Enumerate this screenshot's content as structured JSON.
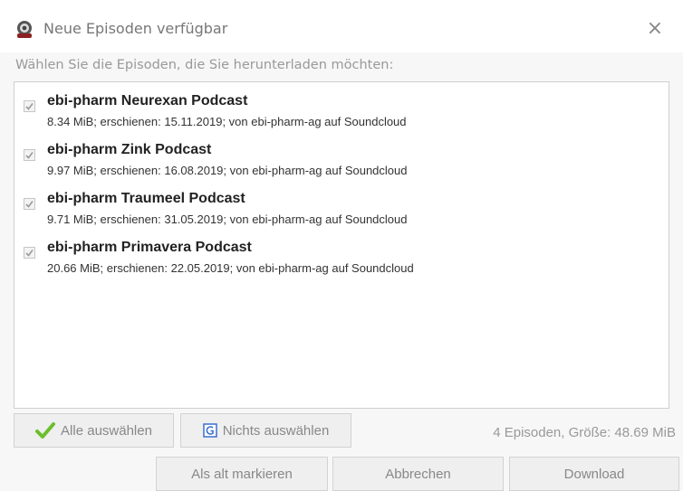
{
  "window": {
    "title": "Neue Episoden verfügbar",
    "close_glyph": "×"
  },
  "prompt": "Wählen Sie die Episoden, die Sie herunterladen möchten:",
  "episodes": [
    {
      "title": "ebi-pharm Neurexan Podcast",
      "meta": "8.34 MiB; erschienen: 15.11.2019; von ebi-pharm-ag auf Soundcloud",
      "checked": true
    },
    {
      "title": "ebi-pharm Zink Podcast",
      "meta": "9.97 MiB; erschienen: 16.08.2019; von ebi-pharm-ag auf Soundcloud",
      "checked": true
    },
    {
      "title": "ebi-pharm Traumeel Podcast",
      "meta": "9.71 MiB; erschienen: 31.05.2019; von ebi-pharm-ag auf Soundcloud",
      "checked": true
    },
    {
      "title": "ebi-pharm Primavera Podcast",
      "meta": "20.66 MiB; erschienen: 22.05.2019; von ebi-pharm-ag auf Soundcloud",
      "checked": true
    }
  ],
  "selection": {
    "select_all_label": "Alle auswählen",
    "select_none_label": "Nichts auswählen",
    "summary": "4 Episoden, Größe: 48.69 MiB"
  },
  "actions": {
    "mark_old_label": "Als alt markieren",
    "cancel_label": "Abbrechen",
    "download_label": "Download"
  },
  "icons": {
    "app": "podcast-app-icon",
    "select_all": "green-checkmark-icon",
    "select_none": "blank-checkbox-icon"
  },
  "colors": {
    "checkmark_green": "#6cbf2c",
    "icon_blue": "#3a6fd0"
  }
}
